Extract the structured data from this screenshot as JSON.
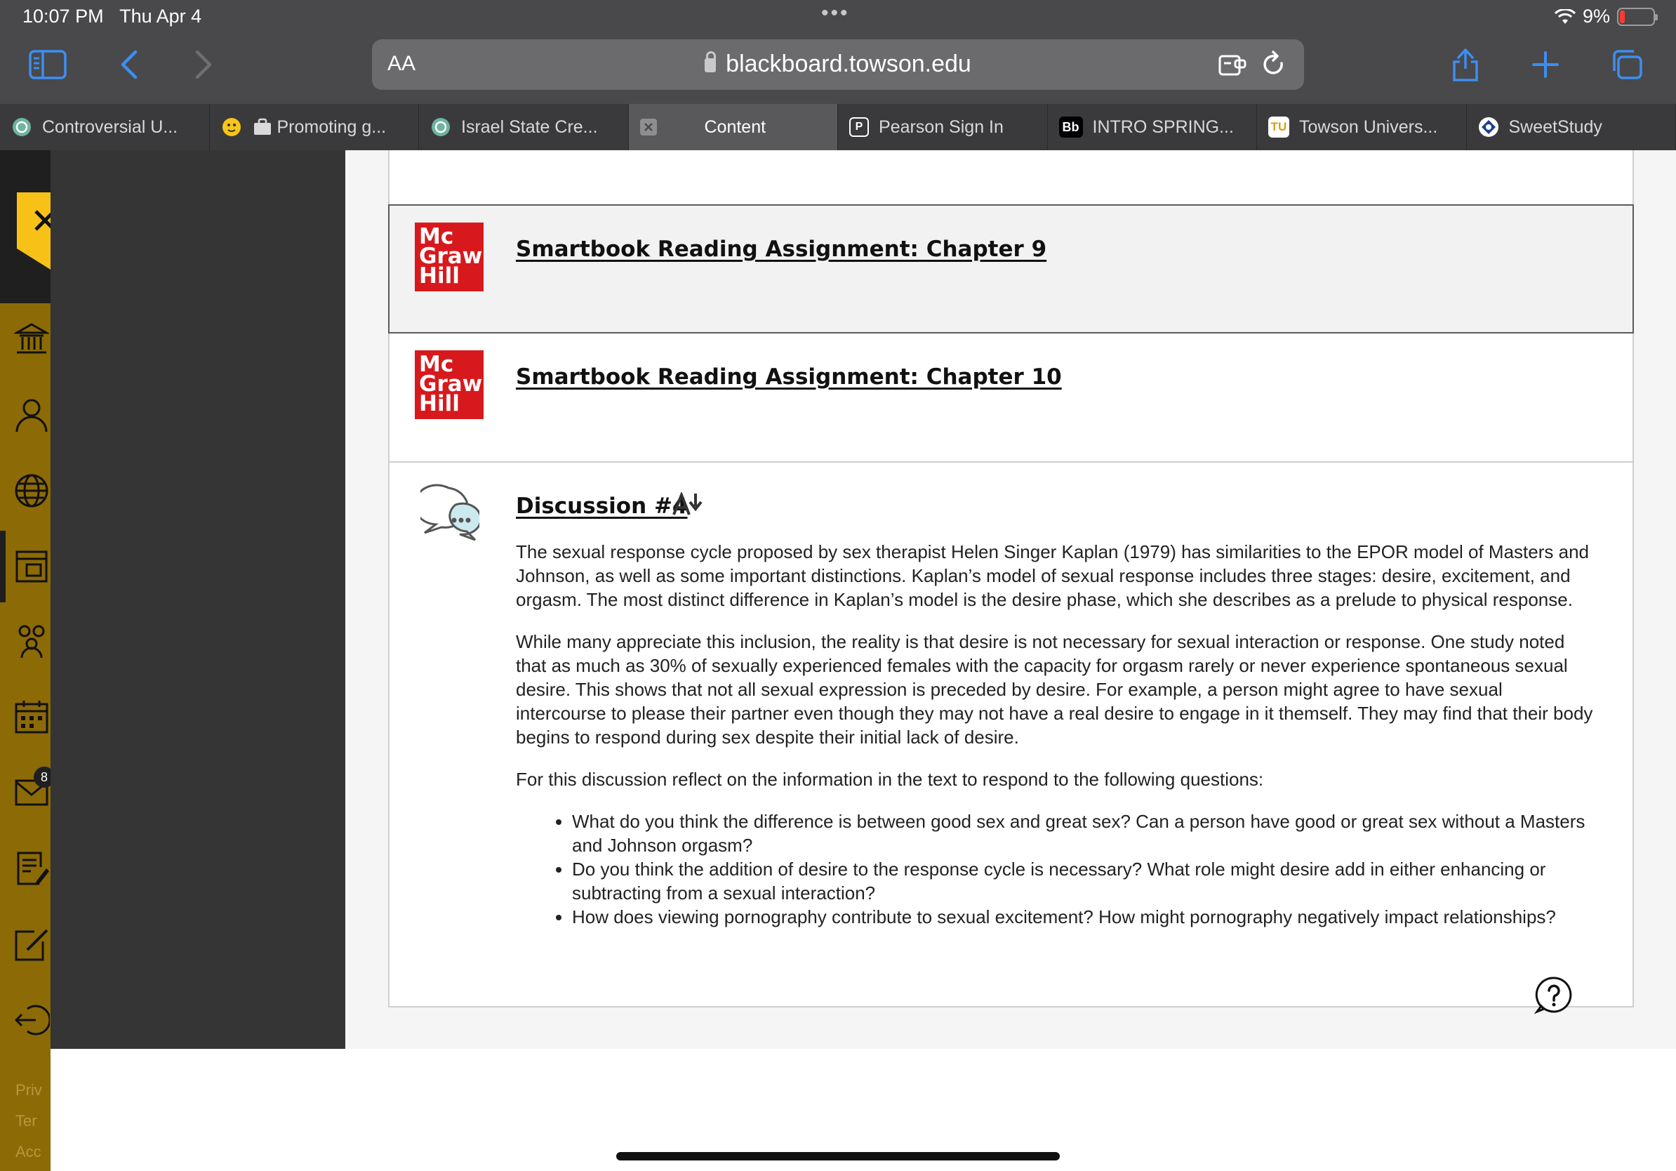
{
  "status_bar": {
    "time": "10:07 PM",
    "date": "Thu Apr 4",
    "battery": "9%"
  },
  "toolbar": {
    "text_size": "AA",
    "url": "blackboard.towson.edu"
  },
  "tabs": [
    {
      "label": "Controversial U...",
      "icon": "chatgpt-icon"
    },
    {
      "label": "Promoting g...",
      "icon": "briefcase-icon"
    },
    {
      "label": "Israel State Cre...",
      "icon": "chatgpt-icon"
    },
    {
      "label": "Content",
      "icon": "close-tab-icon",
      "active": true
    },
    {
      "label": "Pearson Sign In",
      "icon": "pearson-icon"
    },
    {
      "label": "INTRO SPRING...",
      "icon": "blackboard-icon",
      "badge": "Bb"
    },
    {
      "label": "Towson Univers...",
      "icon": "towson-icon",
      "badge": "TU"
    },
    {
      "label": "SweetStudy",
      "icon": "sweetstudy-icon"
    }
  ],
  "sidebar": {
    "mail_badge": "8",
    "footer": [
      "Priv",
      "Ter",
      "Acc"
    ]
  },
  "content": {
    "items": [
      {
        "title": "Smartbook Reading Assignment: Chapter 9",
        "logo": "Mc Graw Hill"
      },
      {
        "title": "Smartbook Reading Assignment: Chapter 10",
        "logo": "Mc Graw Hill"
      }
    ],
    "discussion": {
      "title": "Discussion #4",
      "paragraphs": [
        "The sexual response cycle proposed by sex therapist Helen Singer Kaplan (1979) has similarities to the EPOR model of Masters and Johnson, as well as some important distinctions. Kaplan’s model of sexual response includes three stages: desire, excitement, and orgasm. The most distinct difference in Kaplan’s model is the desire phase, which she describes as a prelude to physical response.",
        "While many appreciate this inclusion, the reality is that desire is not necessary for sexual interaction or response. One study noted that as much as 30% of sexually experienced females with the capacity for orgasm rarely or never experience spontaneous sexual desire. This shows that not all sexual expression is preceded by desire. For example, a person might agree to have sexual intercourse to please their partner even though they may not have a real desire to engage in it themself. They may find that their body begins to respond during sex despite their initial lack of desire.",
        "For this discussion reflect on the information in the text to respond to the following questions:"
      ],
      "questions": [
        "What do you think the difference is between good sex and great sex? Can a person have good or great sex without a Masters and Johnson orgasm?",
        "Do you think the addition of desire to the response cycle is necessary? What role might desire add in either enhancing or subtracting from a sexual interaction?",
        "How does viewing pornography contribute to sexual excitement? How might pornography negatively impact relationships?"
      ]
    }
  },
  "colors": {
    "bb_gold": "#f7c118",
    "bb_nav": "#8c6a06",
    "mcgraw_red": "#d7191d",
    "chrome_bg": "#49494b"
  }
}
